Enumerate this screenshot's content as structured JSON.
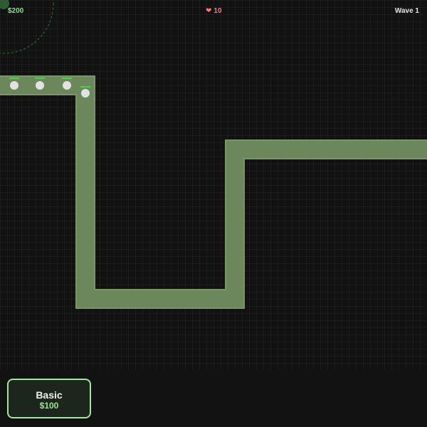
{
  "hud": {
    "money": "$200",
    "lives": "10",
    "wave": "Wave 1"
  },
  "tower_shop": {
    "towers": [
      {
        "name": "Basic",
        "cost": "$100"
      }
    ]
  },
  "colors": {
    "path": "#6f8a5e",
    "path_edge": "#86a572",
    "enemy": "#e2e2e2",
    "health_bar": "#4cd24c",
    "tower": "#2f5a35",
    "range_ring": "#2e7a3a",
    "accent": "#a8e6a0"
  },
  "icons": {
    "lives": "heart-icon"
  }
}
